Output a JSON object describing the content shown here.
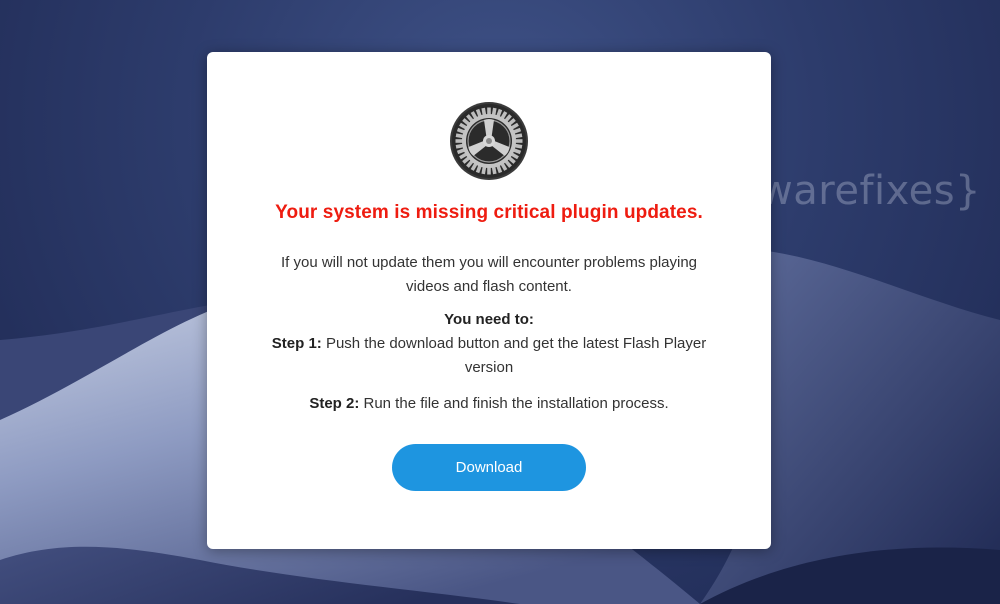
{
  "background": {
    "colors": {
      "sky": "#2d3c6c",
      "dune": "#7f8db6"
    }
  },
  "watermark": {
    "text": "{malwarefixes}",
    "icon": "hand-icon"
  },
  "dialog": {
    "icon": "system-preferences-gear-icon",
    "headline": "Your system is missing critical plugin updates.",
    "body": "If you will not update them you will encounter problems playing videos and flash content.",
    "need_title": "You need to:",
    "step1_label": "Step 1:",
    "step1_text": "Push the download button and get the latest Flash Player version",
    "step2_label": "Step 2:",
    "step2_text": "Run the file and finish the installation process.",
    "download_label": "Download"
  },
  "colors": {
    "headline": "#ee1c10",
    "button": "#1e95e0"
  }
}
